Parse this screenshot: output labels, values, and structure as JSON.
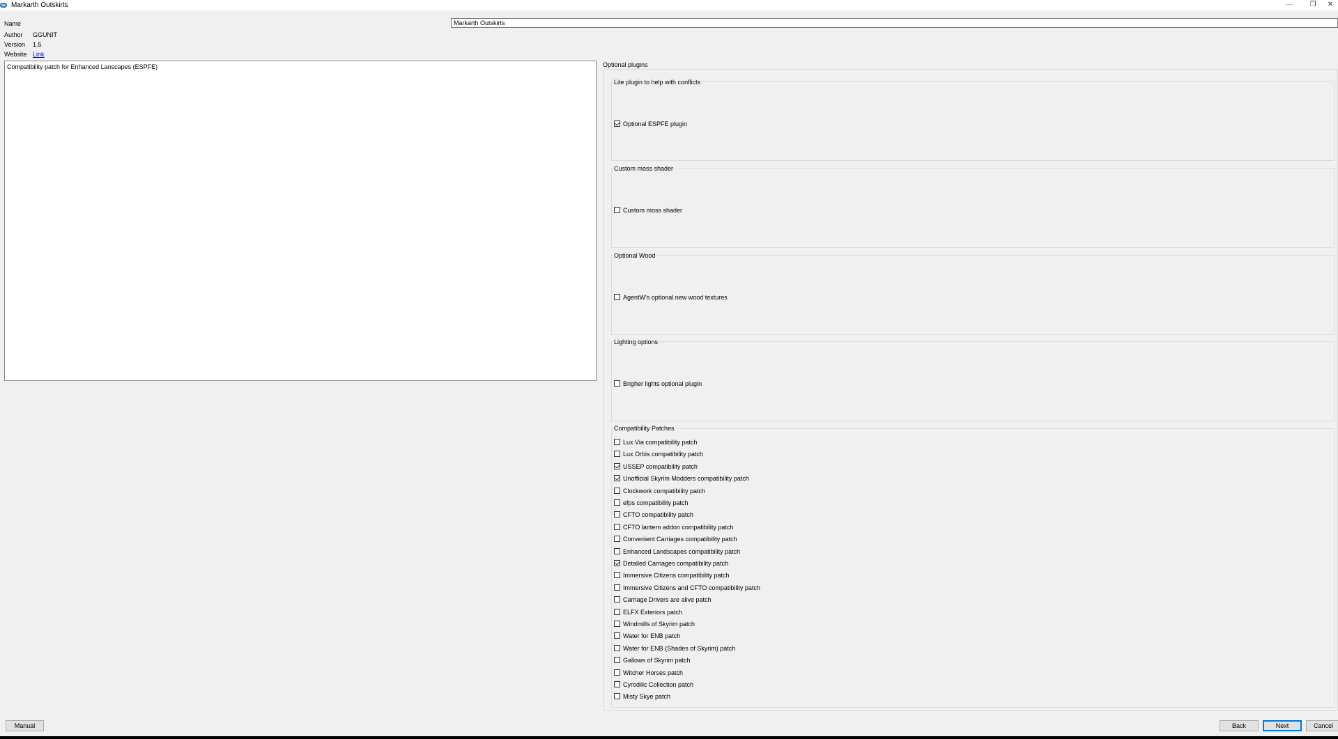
{
  "window": {
    "title": "Markarth Outskirts",
    "minimize_glyph": "—",
    "restore_glyph": "❐",
    "close_glyph": "✕"
  },
  "info": {
    "name_label": "Name",
    "name_value": "Markarth Outskirts",
    "author_label": "Author",
    "author_value": "GGUNIT",
    "version_label": "Version",
    "version_value": "1.5",
    "website_label": "Website",
    "website_value": "Link"
  },
  "description": "Compatibility patch for Enhanced Lanscapes (ESPFE)",
  "optional_plugins_label": "Optional plugins",
  "groups": [
    {
      "title": "Lite plugin to help with conflicts",
      "options": [
        {
          "label": "Optional ESPFE plugin",
          "checked": true
        }
      ]
    },
    {
      "title": "Custom moss shader",
      "options": [
        {
          "label": "Custom moss shader",
          "checked": false
        }
      ]
    },
    {
      "title": "Optional Wood",
      "options": [
        {
          "label": "AgentW's optional new wood textures",
          "checked": false
        }
      ]
    },
    {
      "title": "Lighting options",
      "options": [
        {
          "label": "Brigher lights optional plugin",
          "checked": false
        }
      ]
    },
    {
      "title": "Compatibility Patches",
      "options": [
        {
          "label": "Lux Via compatibility patch",
          "checked": false
        },
        {
          "label": "Lux Orbis compatibility patch",
          "checked": false
        },
        {
          "label": "USSEP compatibility patch",
          "checked": true
        },
        {
          "label": "Unofficial Skyrim Modders compatibility patch",
          "checked": true
        },
        {
          "label": "Clockwork compatibility patch",
          "checked": false
        },
        {
          "label": "efps compatibility patch",
          "checked": false
        },
        {
          "label": "CFTO compatibility patch",
          "checked": false
        },
        {
          "label": "CFTO lantern addon compatibility patch",
          "checked": false
        },
        {
          "label": "Convenient Carriages compatibility patch",
          "checked": false
        },
        {
          "label": "Enhanced Landscapes compatibility patch",
          "checked": false
        },
        {
          "label": "Detailed Carriages compatibility patch",
          "checked": true
        },
        {
          "label": "Immersive Citizens compatibility patch",
          "checked": false
        },
        {
          "label": "Immersive Citizens and CFTO compatibility patch",
          "checked": false
        },
        {
          "label": "Carriage Drivers are alive patch",
          "checked": false
        },
        {
          "label": "ELFX Exteriors patch",
          "checked": false
        },
        {
          "label": "Windmills of Skyrim patch",
          "checked": false
        },
        {
          "label": "Water for ENB patch",
          "checked": false
        },
        {
          "label": "Water for ENB (Shades of Skyrim) patch",
          "checked": false
        },
        {
          "label": "Gallows of Skyrim patch",
          "checked": false
        },
        {
          "label": "Witcher Horses patch",
          "checked": false
        },
        {
          "label": "Cyrodilic Collection patch",
          "checked": false
        },
        {
          "label": "Misty Skye patch",
          "checked": false
        }
      ]
    }
  ],
  "buttons": {
    "manual": "Manual",
    "back": "Back",
    "next": "Next",
    "cancel": "Cancel"
  },
  "colors": {
    "background": "#f0f0f0",
    "accent": "#0078d7",
    "link": "#0000ee"
  }
}
